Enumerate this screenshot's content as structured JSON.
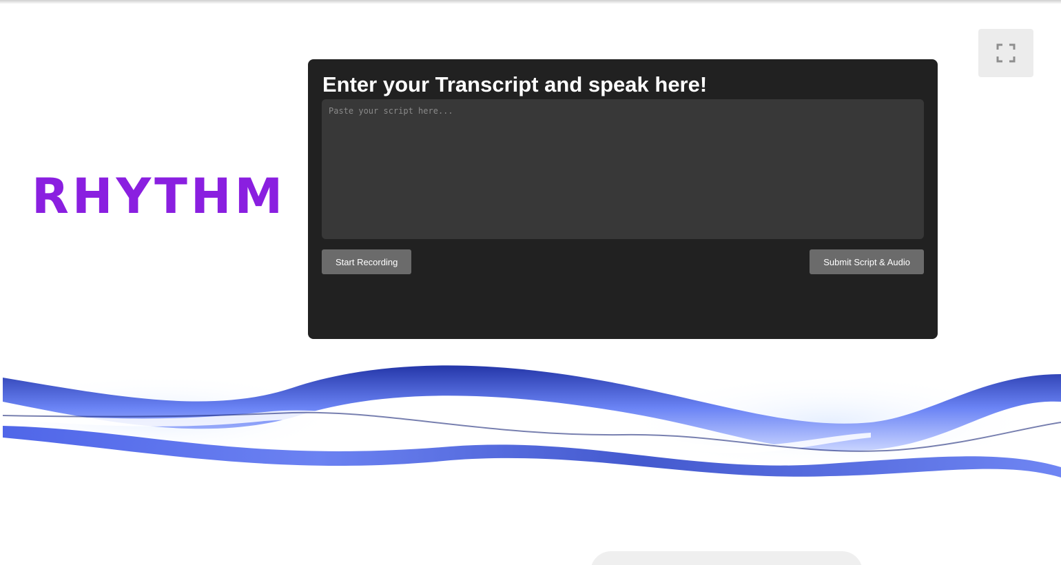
{
  "brand": {
    "logo_text": "RHYTHM",
    "logo_color": "#8a1fe0"
  },
  "toolbar": {
    "fullscreen_icon": "fullscreen-icon"
  },
  "panel": {
    "title": "Enter your Transcript and speak here!",
    "script_input": {
      "value": "",
      "placeholder": "Paste your script here..."
    },
    "start_recording_label": "Start Recording",
    "submit_label": "Submit Script & Audio"
  },
  "colors": {
    "panel_bg": "#212121",
    "input_bg": "#383838",
    "button_bg": "#6b6b6b",
    "wave_blue": "#4a5fe0"
  }
}
